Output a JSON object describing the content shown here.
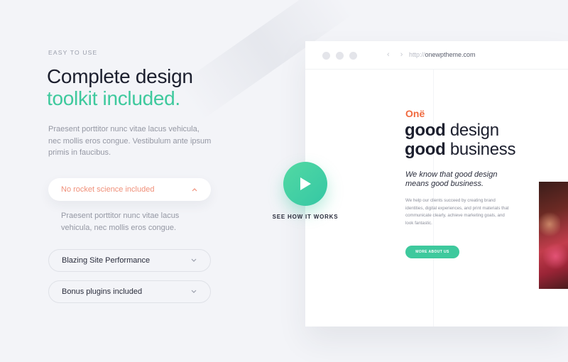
{
  "section": {
    "eyebrow": "EASY TO USE",
    "headline_line1": "Complete design",
    "headline_line2": "toolkit included.",
    "intro": "Praesent porttitor nunc vitae lacus vehicula, nec mollis eros congue. Vestibulum ante ipsum primis in faucibus."
  },
  "accordion": {
    "items": [
      {
        "label": "No rocket science included",
        "expanded": true,
        "body": "Praesent porttitor nunc vitae lacus vehicula, nec mollis eros congue."
      },
      {
        "label": "Blazing Site Performance",
        "expanded": false
      },
      {
        "label": "Bonus plugins included",
        "expanded": false
      }
    ]
  },
  "video": {
    "caption": "SEE HOW IT WORKS"
  },
  "browser": {
    "nav": "‹ ›",
    "url_protocol": "http://",
    "url_domain": "onewptheme.com",
    "brand": "Onë",
    "heading_bold1": "good",
    "heading_rest1": " design",
    "heading_bold2": "good",
    "heading_rest2": " business",
    "tagline": "We know that good design means good business.",
    "copy": "We help our clients succeed by creating brand identities, digital experiences, and print materials that communicate clearly, achieve marketing goals, and look fantastic.",
    "cta_label": "MORE ABOUT US"
  },
  "colors": {
    "accent": "#3ec99d",
    "expanded_label": "#f0907a",
    "brand": "#f06a3f"
  },
  "icons": {
    "chevron_up": "chevron-up-icon",
    "chevron_down": "chevron-down-icon",
    "play": "play-icon"
  }
}
